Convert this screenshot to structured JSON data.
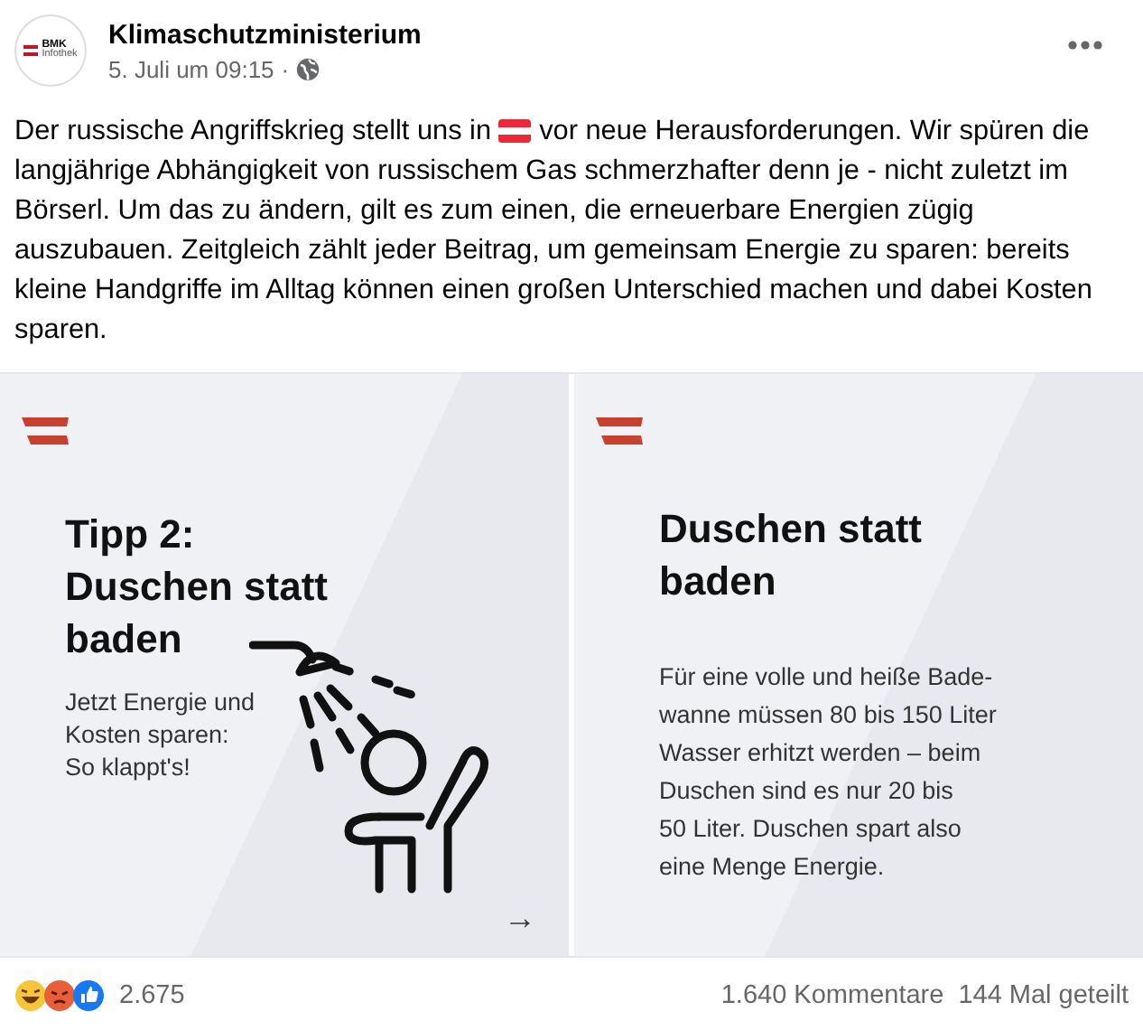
{
  "post": {
    "author": "Klimaschutzministerium",
    "avatar_text": [
      "BMK",
      "Infothek"
    ],
    "date": "5. Juli um 09:15",
    "separator": "·",
    "text_before_flag": "Der russische Angriffskrieg stellt uns in",
    "text_after_flag": "vor neue Herausforderungen. Wir spüren die langjährige Abhängigkeit von russischem Gas schmerzhafter denn je - nicht zuletzt im Börserl. Um das zu ändern, gilt es zum einen, die erneuerbare Energien zügig auszubauen. Zeitgleich zählt jeder Beitrag, um gemeinsam Energie zu sparen: bereits kleine Handgriffe im Alltag können einen großen Unterschied machen und dabei Kosten sparen."
  },
  "cards": [
    {
      "kind": "cover",
      "title_lines": [
        "Tipp 2:",
        "Duschen statt",
        "baden"
      ],
      "subtitle_lines": [
        "Jetzt Energie und",
        "Kosten sparen:",
        "So klappt's!"
      ],
      "arrow": "→"
    },
    {
      "kind": "info",
      "title_lines": [
        "Duschen statt",
        "baden"
      ],
      "body_lines": [
        "Für eine volle und heiße Bade-",
        "wanne müssen 80 bis 150 Liter",
        "Wasser erhitzt werden – beim",
        "Duschen sind es nur 20 bis",
        "50 Liter. Duschen spart also",
        "eine Menge Energie."
      ]
    }
  ],
  "footer": {
    "reaction_count": "2.675",
    "comments": "1.640 Kommentare",
    "shares": "144 Mal geteilt"
  }
}
